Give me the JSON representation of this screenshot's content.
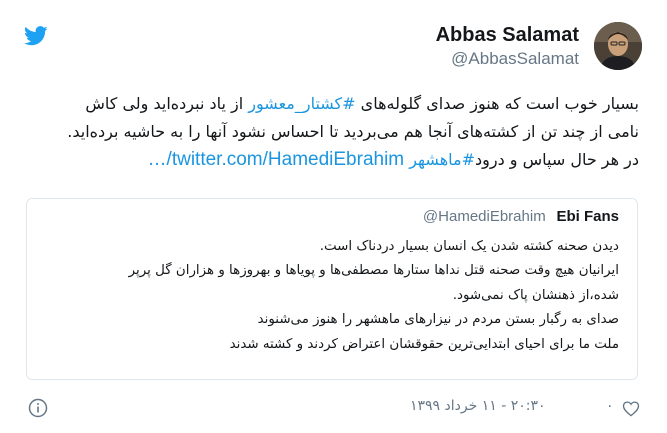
{
  "header": {
    "display_name": "Abbas Salamat",
    "handle": "@AbbasSalamat",
    "brand_color": "#1da1f2",
    "logo_icon": "twitter-bird-icon"
  },
  "tweet": {
    "line1_a": "بسیار خوب است که هنوز صدای گلوله‌های ",
    "hashtag1": "#کشتار_معشور",
    "line1_b": " از یاد نبرده‌اید ولی کاش",
    "line2": "نامی از چند تن از کشته‌های آنجا هم می‌بردید تا احساس نشود آنها را به حاشیه برده‌اید.",
    "line3_a": "در هر حال سپاس و درود",
    "hashtag2": "#ماهشهر",
    "link_url": "twitter.com/HamediEbrahim/…"
  },
  "quote": {
    "name": "Ebi Fans",
    "handle": "@HamediEbrahim",
    "lines": [
      "دیدن صحنه کشته شدن یک انسان بسیار دردناک است.",
      "ایرانیان هیچ وقت صحنه قتل نداها ستارها مصطفی‌ها و پویاها و بهروزها و هزاران گل پرپر",
      "شده،از ذهنشان پاک نمی‌شود.",
      "صدای به رگبار بستن مردم در نیزارهای ماهشهر را هنوز می‌شنوند",
      "ملت ما برای احیای ابتدایی‌ترین حقوقشان اعتراض کردند و کشته شدند"
    ]
  },
  "footer": {
    "date": "۲۰:۳۰ - ۱۱ خرداد ۱۳۹۹",
    "likes": "۰",
    "heart_icon": "heart-icon",
    "info_icon": "info-icon"
  }
}
